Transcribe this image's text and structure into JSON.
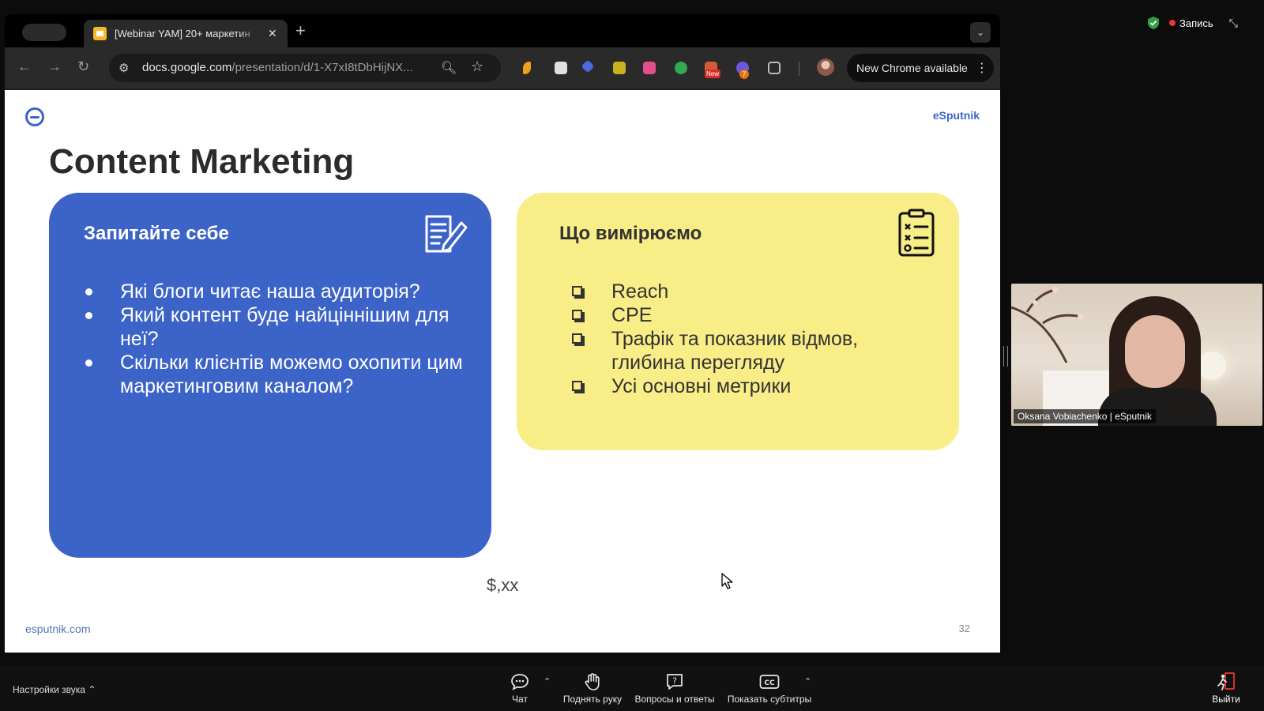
{
  "browser": {
    "tab_title": "[Webinar YAM] 20+ маркетин",
    "tab_close": "✕",
    "new_tab": "+",
    "url_host": "docs.google.com",
    "url_path": "/presentation/d/1-X7xI8tDbHijNX...",
    "chrome_update_label": "New Chrome available",
    "ext_new_badge": "New",
    "ext_count_badge": "7"
  },
  "slide": {
    "brand": "eSputnik",
    "title": "Content Marketing",
    "left_card": {
      "heading": "Запитайте себе",
      "items": [
        "Які блоги читає наша аудиторія?",
        "Який контент буде найціннішим для неї?",
        "Скільки клієнтів можемо охопити цим маркетинговим каналом?"
      ]
    },
    "right_card": {
      "heading": "Що вимірюємо",
      "items": [
        "Reach",
        "CPE",
        "Трафік та показник відмов, глибина перегляду",
        "Усі основні метрики"
      ]
    },
    "price": "$,хх",
    "footer_url": "esputnik.com",
    "page_number": "32",
    "colors": {
      "blue_card": "#3c63c7",
      "yellow_card": "#f8ed86",
      "brand": "#3b63c9"
    }
  },
  "meeting": {
    "recording_label": "Запись",
    "participant_name": "Oksana Vobiachenko | eSputnik",
    "audio_settings": "Настройки звука",
    "buttons": {
      "chat": "Чат",
      "raise_hand": "Поднять руку",
      "qa": "Вопросы и ответы",
      "captions": "Показать субтитры",
      "leave": "Выйти"
    }
  }
}
